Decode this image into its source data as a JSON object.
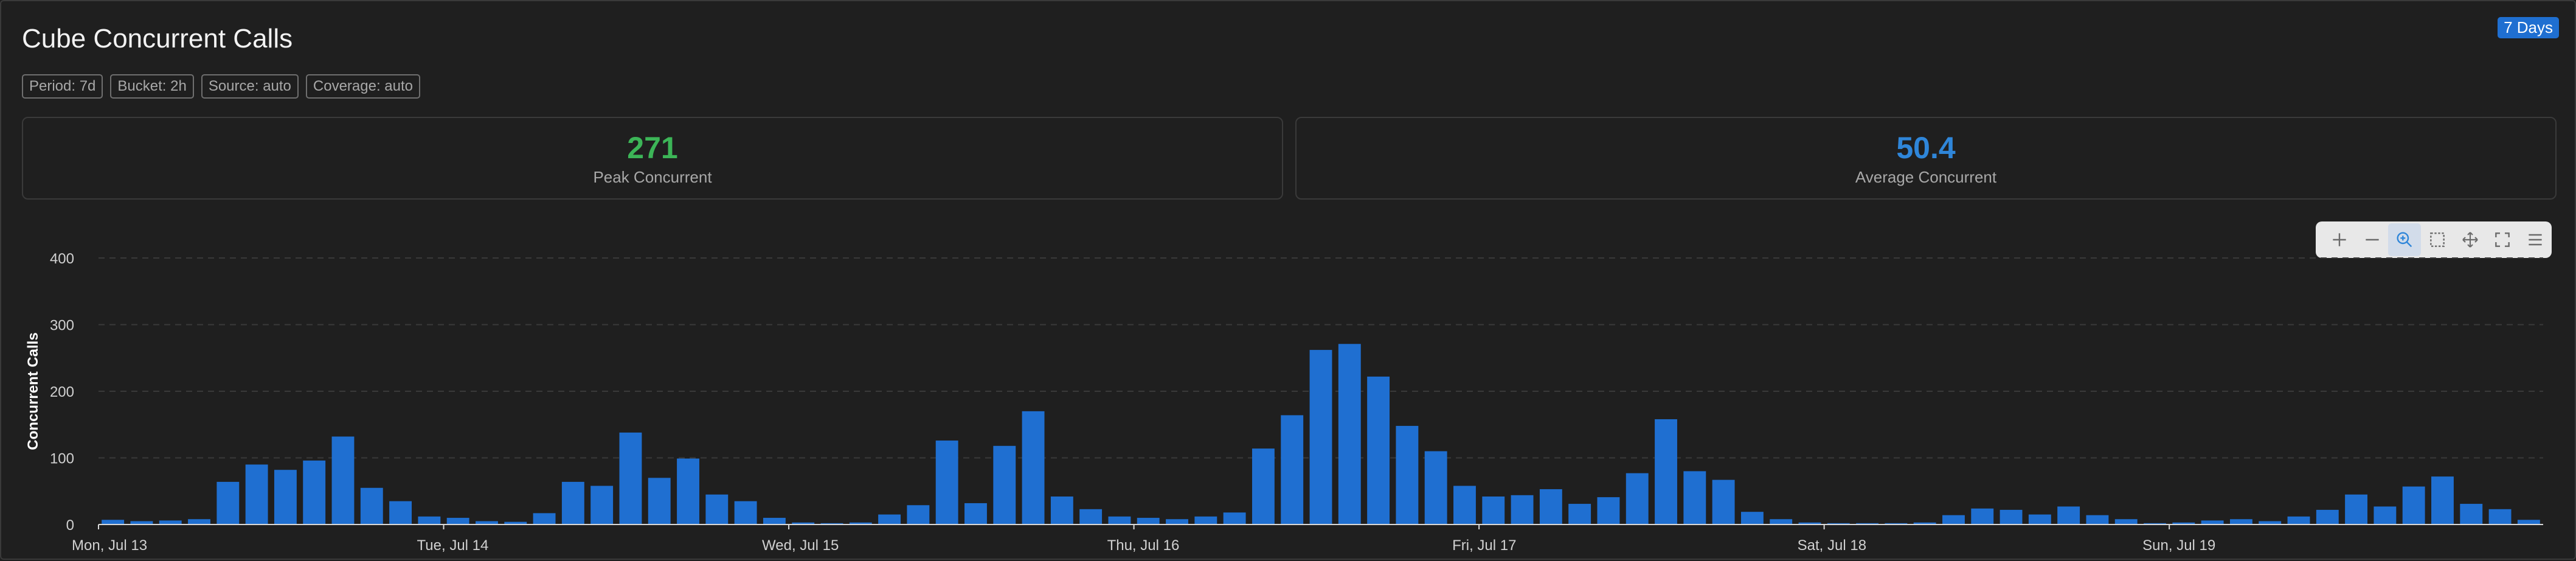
{
  "header": {
    "title": "Cube Concurrent Calls",
    "range_badge": "7 Days"
  },
  "chips": [
    "Period: 7d",
    "Bucket: 2h",
    "Source: auto",
    "Coverage: auto"
  ],
  "stats": {
    "peak": {
      "value": "271",
      "label": "Peak Concurrent",
      "color": "#3cb557"
    },
    "average": {
      "value": "50.4",
      "label": "Average Concurrent",
      "color": "#2f86d9"
    }
  },
  "toolbox": {
    "tools": [
      "plus-icon",
      "minus-icon",
      "zoom-in-icon",
      "select-box-icon",
      "pan-icon",
      "fullscreen-icon",
      "menu-icon"
    ],
    "active": "zoom-in-icon",
    "accent": "#2f86d9"
  },
  "colors": {
    "bar": "#1f6fd1",
    "grid": "#3a3a3a",
    "axis_text": "#d0d0d0"
  },
  "chart_data": {
    "type": "bar",
    "title": "",
    "xlabel": "",
    "ylabel": "Concurrent Calls",
    "ylim": [
      0,
      400
    ],
    "yticks": [
      0,
      100,
      200,
      300,
      400
    ],
    "grid": true,
    "x_tick_labels": [
      "Mon, Jul 13",
      "Tue, Jul 14",
      "Wed, Jul 15",
      "Thu, Jul 16",
      "Fri, Jul 17",
      "Sat, Jul 18",
      "Sun, Jul 19"
    ],
    "bucket": "2h",
    "series": [
      {
        "values": [
          7,
          5,
          6,
          8,
          64,
          90,
          82,
          96,
          132,
          55,
          35,
          12,
          10,
          5,
          4,
          17,
          64,
          58,
          138,
          70,
          99,
          45,
          35,
          10,
          3,
          2,
          3,
          15,
          29,
          126,
          32,
          118,
          170,
          42,
          23,
          12,
          10,
          8,
          12,
          18,
          114,
          164,
          262,
          271,
          222,
          148,
          110,
          58,
          42,
          44,
          53,
          31,
          41,
          77,
          158,
          80,
          67,
          19,
          8,
          3,
          2,
          2,
          2,
          3,
          14,
          24,
          22,
          15,
          27,
          14,
          8,
          2,
          3,
          6,
          8,
          5,
          12,
          22,
          45,
          27,
          57,
          72,
          31,
          23,
          7
        ]
      }
    ]
  }
}
